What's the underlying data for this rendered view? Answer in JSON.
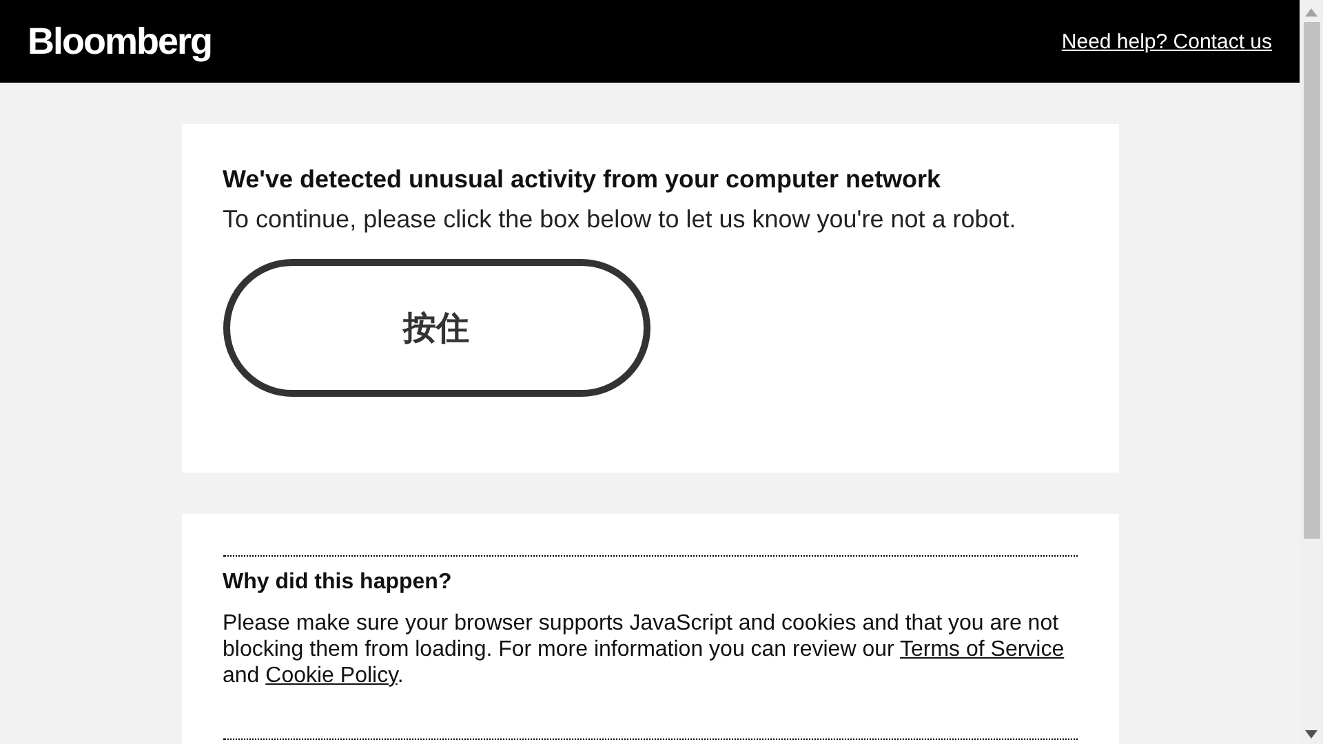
{
  "header": {
    "logo": "Bloomberg",
    "help_link": "Need help? Contact us"
  },
  "challenge": {
    "title": "We've detected unusual activity from your computer network",
    "instruction": "To continue, please click the box below to let us know you're not a robot.",
    "hold_button": "按住"
  },
  "why": {
    "title": "Why did this happen?",
    "text_before": "Please make sure your browser supports JavaScript and cookies and that you are not blocking them from loading. For more information you can review our ",
    "link_terms": "Terms of Service",
    "text_middle": " and ",
    "link_cookie": "Cookie Policy",
    "text_after": "."
  }
}
